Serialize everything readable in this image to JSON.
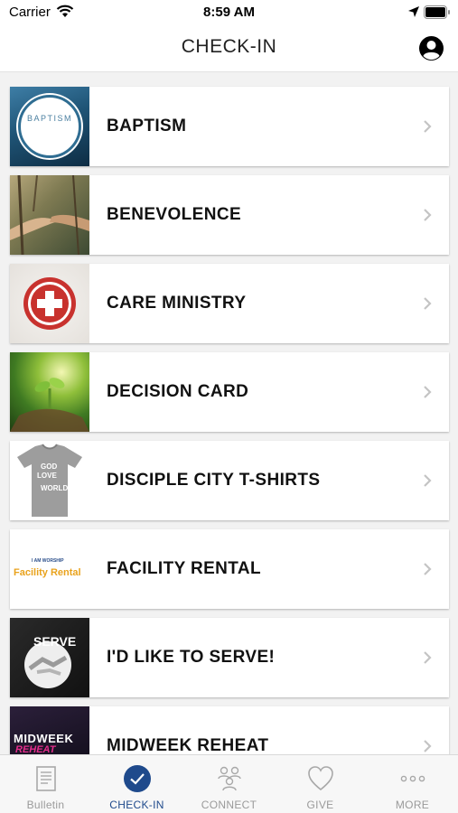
{
  "status_bar": {
    "carrier": "Carrier",
    "time": "8:59 AM"
  },
  "header": {
    "title": "CHECK-IN",
    "profile_icon": "user-circle-icon"
  },
  "list": {
    "items": [
      {
        "label": "BAPTISM",
        "thumb_text": "BAPTISM"
      },
      {
        "label": "BENEVOLENCE"
      },
      {
        "label": "CARE MINISTRY"
      },
      {
        "label": "DECISION CARD"
      },
      {
        "label": "DISCIPLE CITY T-SHIRTS",
        "thumb_text_1": "GOD",
        "thumb_text_2": "LOVE",
        "thumb_text_3": "WORLD"
      },
      {
        "label": "FACILITY RENTAL",
        "thumb_text_1": "I AM WORSHIP",
        "thumb_text_2": "Facility Rental"
      },
      {
        "label": "I'D LIKE TO SERVE!",
        "thumb_text": "SERVE"
      },
      {
        "label": "MIDWEEK REHEAT",
        "thumb_text_1": "MIDWEEK",
        "thumb_text_2": "REHEAT"
      }
    ]
  },
  "tab_bar": {
    "tabs": [
      {
        "label": "Bulletin",
        "icon": "bulletin-icon",
        "active": false
      },
      {
        "label": "CHECK-IN",
        "icon": "checkmark-circle-icon",
        "active": true
      },
      {
        "label": "CONNECT",
        "icon": "people-connect-icon",
        "active": false
      },
      {
        "label": "GIVE",
        "icon": "heart-icon",
        "active": false
      },
      {
        "label": "MORE",
        "icon": "more-dots-icon",
        "active": false
      }
    ]
  },
  "colors": {
    "accent": "#1f4a8c",
    "background": "#f2f2f2",
    "tab_inactive": "#9a9a9a"
  }
}
